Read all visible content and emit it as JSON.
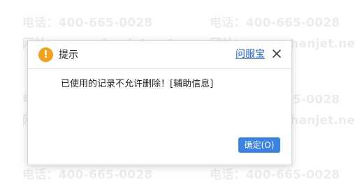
{
  "watermark": {
    "phone_text": "电话：400-665-0028",
    "site_text": "网址：www.chanjet.net"
  },
  "dialog": {
    "title": "提示",
    "help_link": "问服宝",
    "message": "已使用的记录不允许删除！[辅助信息]",
    "ok_label": "确定(O)"
  },
  "icons": {
    "warning": "warning-icon",
    "close": "close-icon"
  },
  "colors": {
    "warning": "#f0a21b",
    "link": "#1f5fd0",
    "primary_button": "#3b82e6"
  }
}
